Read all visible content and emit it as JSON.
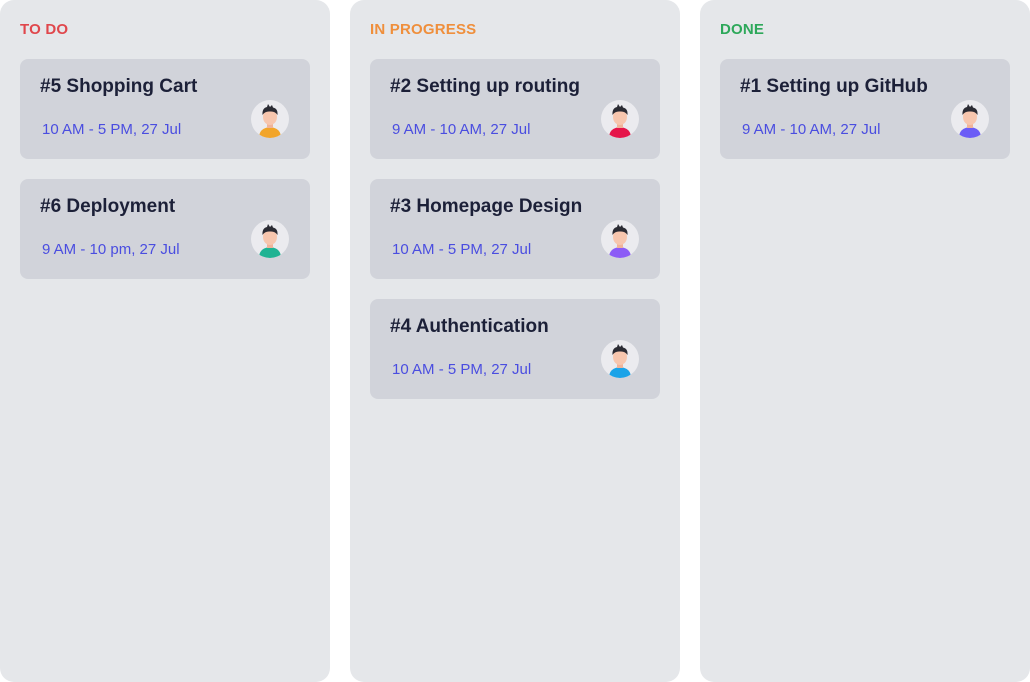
{
  "columns": [
    {
      "title": "TO DO",
      "color": "#e0474c",
      "cards": [
        {
          "title": "#5 Shopping Cart",
          "time": "10 AM - 5 PM, 27 Jul",
          "avatar_icon": "person-avatar-icon",
          "shirt_color": "#f2a52a"
        },
        {
          "title": "#6 Deployment",
          "time": "9 AM - 10 pm, 27 Jul",
          "avatar_icon": "person-avatar-icon",
          "shirt_color": "#1fb393"
        }
      ]
    },
    {
      "title": "IN PROGRESS",
      "color": "#ef8f3c",
      "cards": [
        {
          "title": "#2 Setting up routing",
          "time": "9 AM - 10 AM, 27 Jul",
          "avatar_icon": "person-avatar-icon",
          "shirt_color": "#e5154a"
        },
        {
          "title": "#3 Homepage Design",
          "time": "10 AM - 5 PM, 27 Jul",
          "avatar_icon": "person-avatar-icon",
          "shirt_color": "#8c5cf6"
        },
        {
          "title": "#4 Authentication",
          "time": "10 AM - 5 PM, 27 Jul",
          "avatar_icon": "person-avatar-icon",
          "shirt_color": "#1aa3e8"
        }
      ]
    },
    {
      "title": "DONE",
      "color": "#2da85a",
      "cards": [
        {
          "title": "#1 Setting up GitHub",
          "time": "9 AM - 10 AM, 27 Jul",
          "avatar_icon": "person-avatar-icon",
          "shirt_color": "#6b5cf6"
        }
      ]
    }
  ]
}
